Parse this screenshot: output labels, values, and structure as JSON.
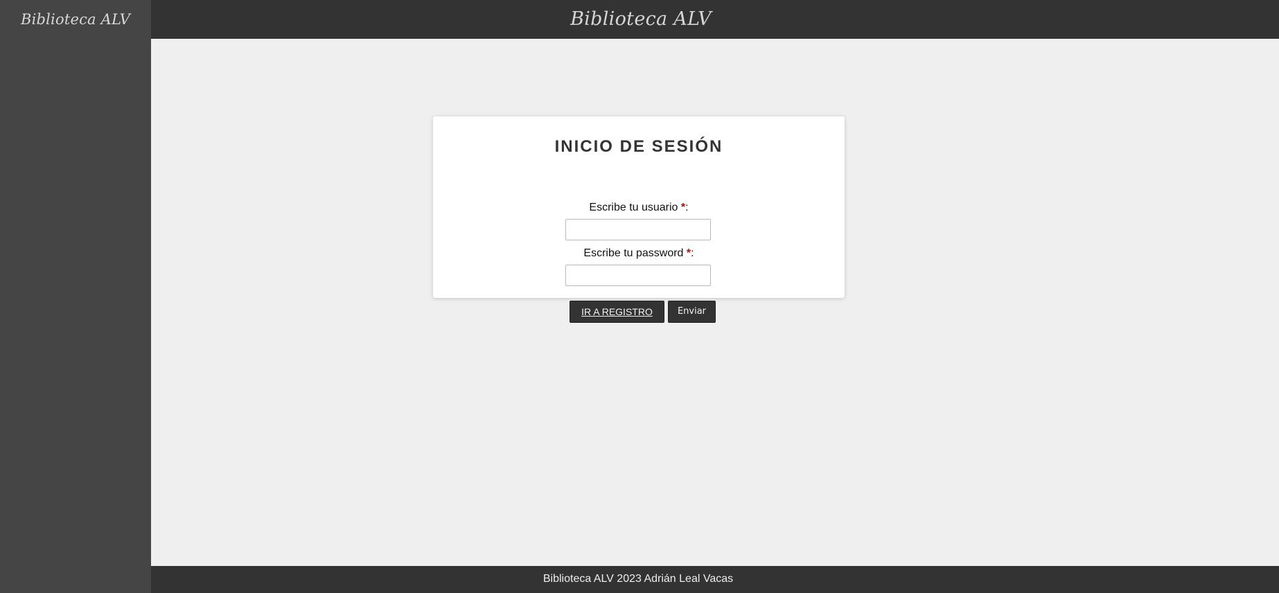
{
  "sidebar": {
    "brand": "Biblioteca ALV"
  },
  "header": {
    "title": "Biblioteca ALV"
  },
  "login": {
    "title": "INICIO DE SESIÓN",
    "username_label": "Escribe tu usuario ",
    "password_label": "Escribe tu password ",
    "required_mark": "*",
    "label_suffix": ":",
    "username_value": "",
    "password_value": "",
    "register_button": "IR A REGISTRO",
    "submit_button": "Enviar"
  },
  "footer": {
    "text": "Biblioteca ALV 2023 Adrián Leal Vacas"
  },
  "colors": {
    "sidebar_bg": "#454545",
    "topbar_bg": "#333333",
    "main_bg": "#efefef",
    "card_bg": "#ffffff",
    "button_bg": "#333333",
    "required_red": "#cc0000"
  }
}
